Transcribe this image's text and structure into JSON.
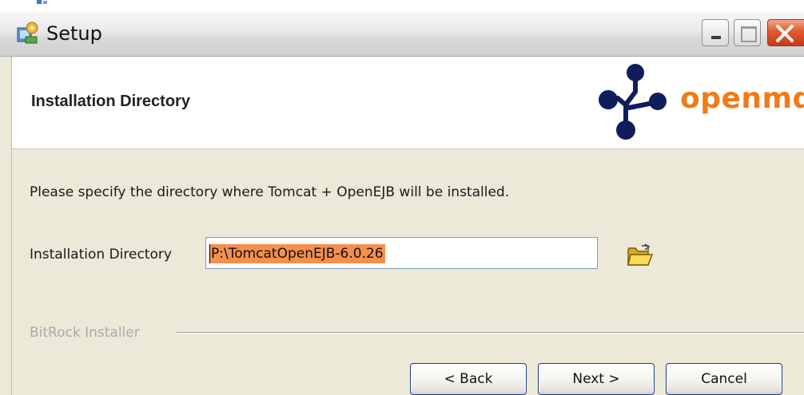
{
  "window": {
    "title": "Setup",
    "app_icon": "setup-icon",
    "controls": {
      "minimize": "minimize-icon",
      "maximize": "maximize-icon",
      "close": "close-icon"
    }
  },
  "header": {
    "title": "Installation Directory",
    "logo_text": "openmdx",
    "logo_icon": "openmdx-logo-icon"
  },
  "form": {
    "instructions": "Please specify the directory where Tomcat + OpenEJB will be installed.",
    "directory_label": "Installation Directory",
    "directory_value": "P:\\TomcatOpenEJB-6.0.26",
    "browse_icon": "folder-open-icon"
  },
  "footer": {
    "brand": "BitRock Installer",
    "back_label": "< Back",
    "next_label": "Next >",
    "cancel_label": "Cancel"
  },
  "colors": {
    "accent_orange": "#f07b17",
    "logo_navy": "#0f1e5a",
    "selection": "#f58f4d",
    "button_border": "#1f3d8a"
  }
}
